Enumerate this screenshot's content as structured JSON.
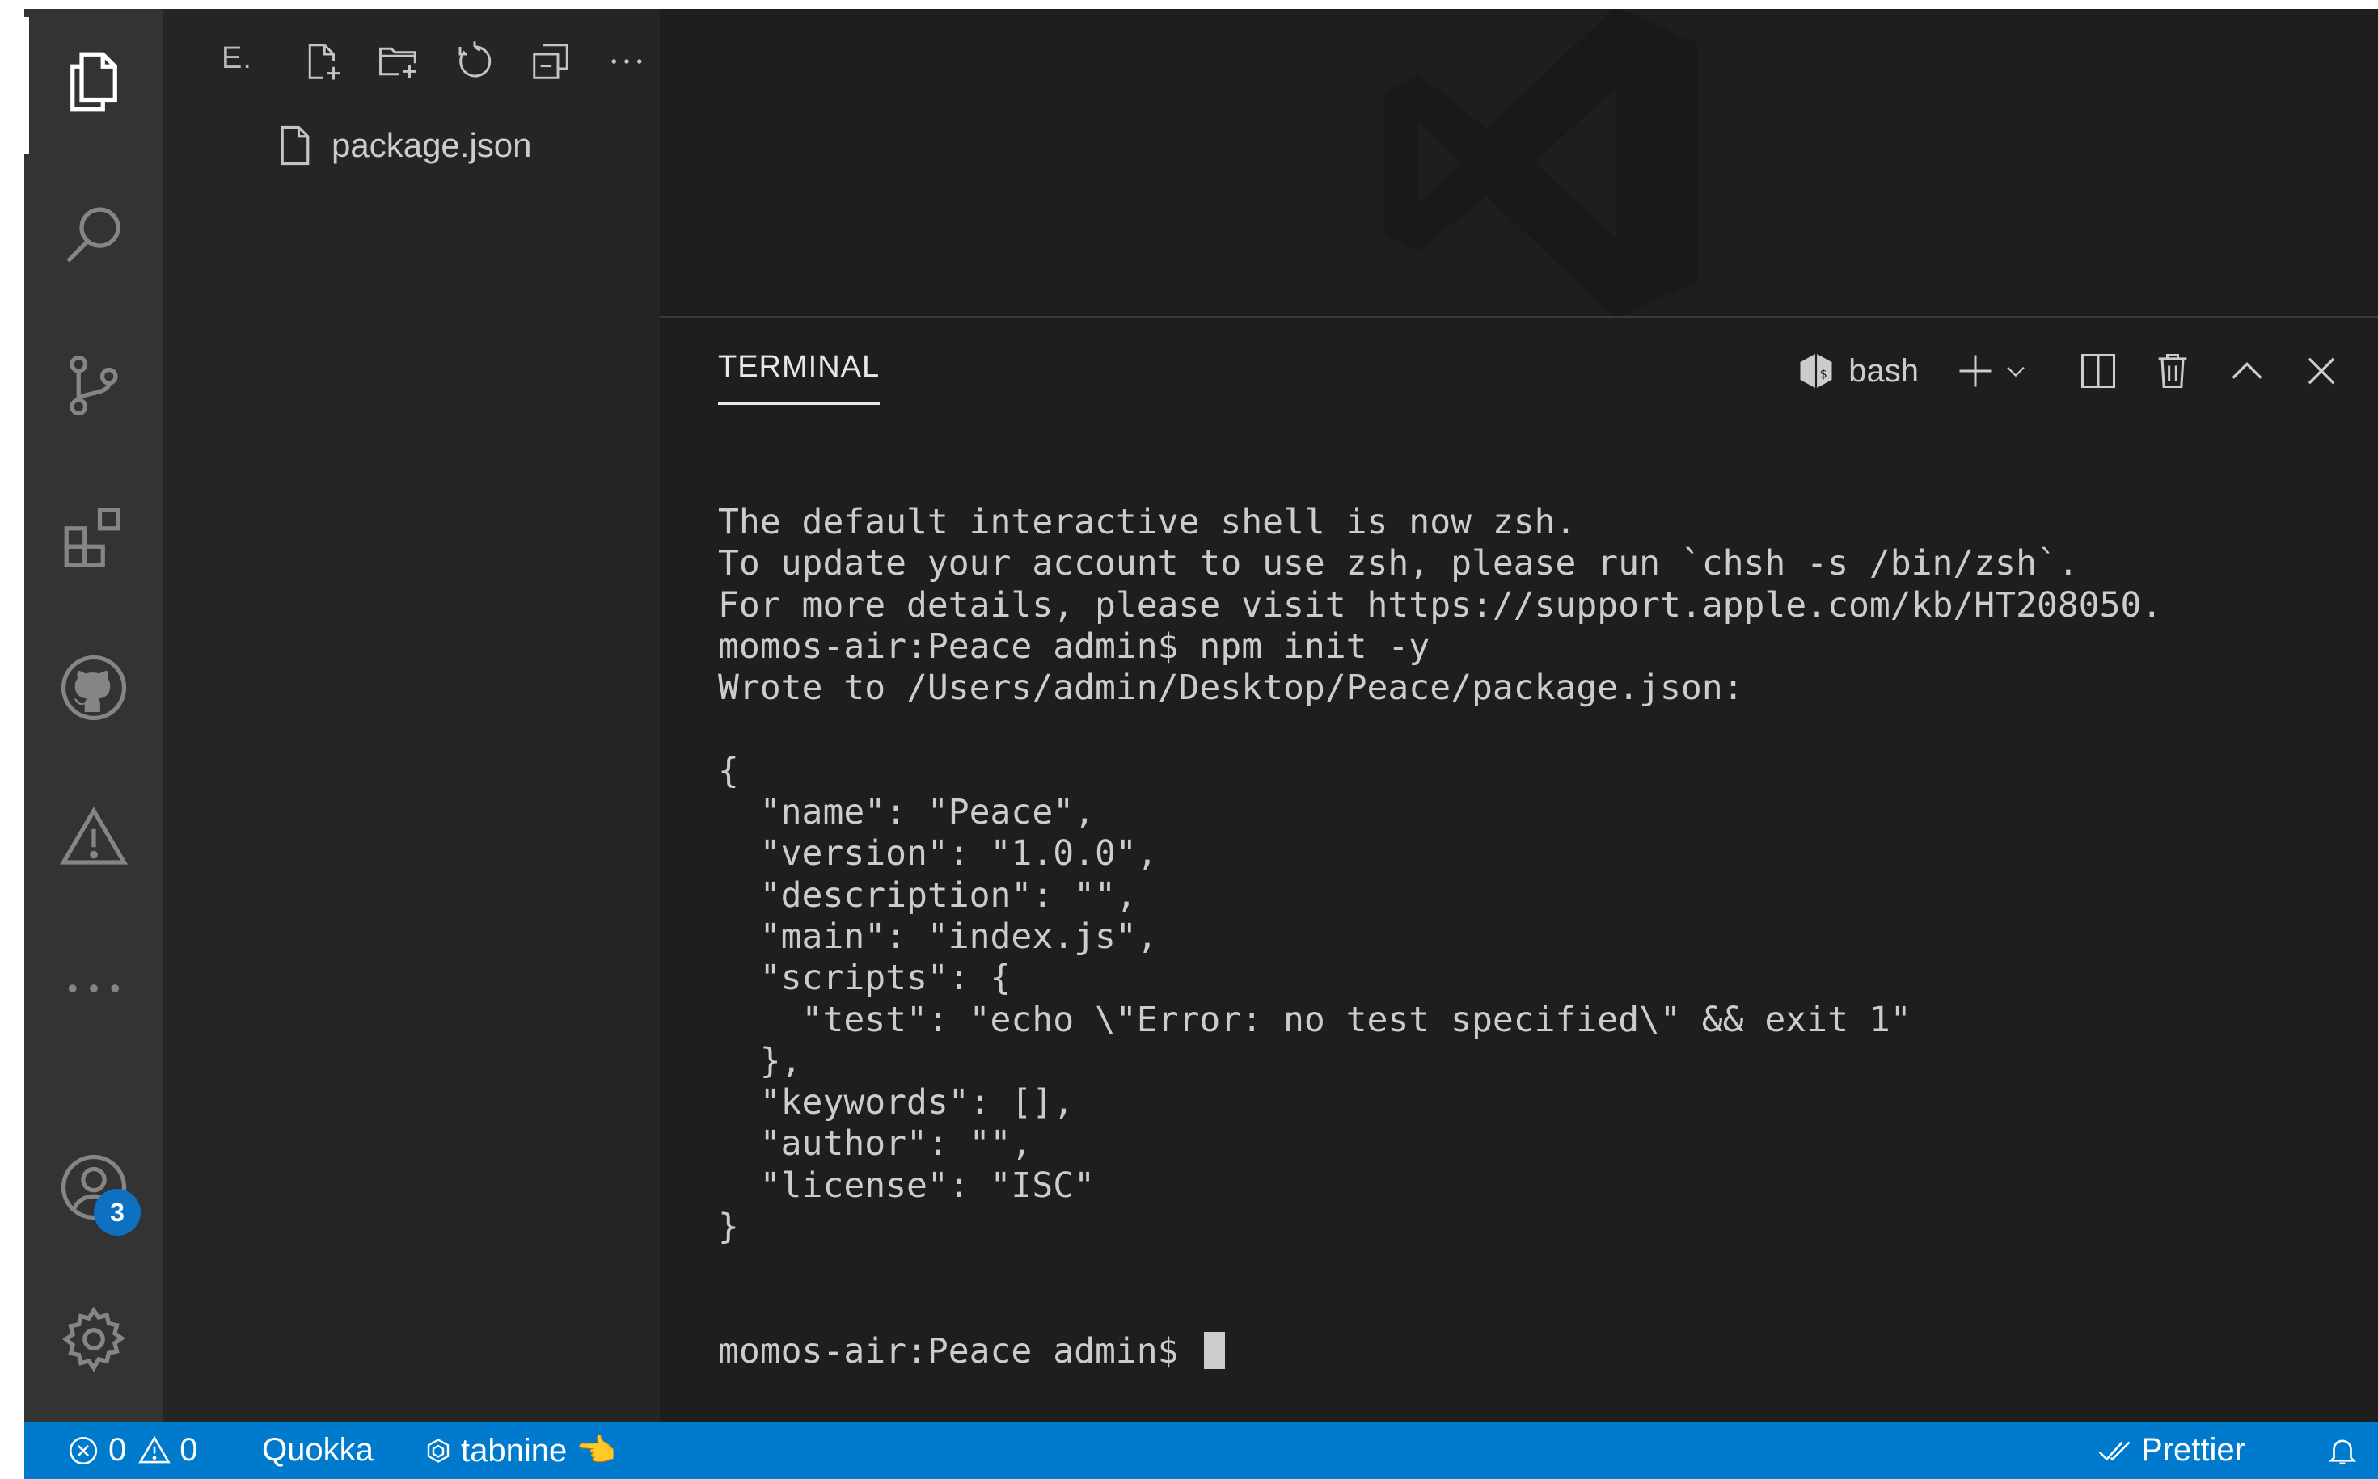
{
  "sidebar": {
    "title": "E.",
    "files": [
      {
        "name": "package.json"
      }
    ]
  },
  "activity_bar": {
    "accounts_badge": "3"
  },
  "panel": {
    "tab_label": "TERMINAL",
    "shell_name": "bash"
  },
  "terminal": {
    "lines": [
      "The default interactive shell is now zsh.",
      "To update your account to use zsh, please run `chsh -s /bin/zsh`.",
      "For more details, please visit https://support.apple.com/kb/HT208050.",
      "momos-air:Peace admin$ npm init -y",
      "Wrote to /Users/admin/Desktop/Peace/package.json:",
      "",
      "{",
      "  \"name\": \"Peace\",",
      "  \"version\": \"1.0.0\",",
      "  \"description\": \"\",",
      "  \"main\": \"index.js\",",
      "  \"scripts\": {",
      "    \"test\": \"echo \\\"Error: no test specified\\\" && exit 1\"",
      "  },",
      "  \"keywords\": [],",
      "  \"author\": \"\",",
      "  \"license\": \"ISC\"",
      "}",
      "",
      ""
    ],
    "prompt": "momos-air:Peace admin$ "
  },
  "status_bar": {
    "errors": "0",
    "warnings": "0",
    "quokka": "Quokka",
    "tabnine": "tabnine 👈",
    "prettier": "Prettier"
  },
  "colors": {
    "statusbar_bg": "#007acc",
    "badge_bg": "#0e70c0",
    "activity_bg": "#333333",
    "sidebar_bg": "#252526",
    "editor_bg": "#1e1e1e"
  },
  "icons": {
    "activity": [
      "explorer-icon",
      "search-icon",
      "source-control-icon",
      "extensions-icon",
      "github-icon",
      "problems-icon",
      "more-icon",
      "accounts-icon",
      "settings-gear-icon"
    ],
    "explorer_toolbar": [
      "new-file-icon",
      "new-folder-icon",
      "refresh-icon",
      "collapse-all-icon",
      "more-actions-icon"
    ],
    "panel_toolbar": [
      "bash-shell-icon",
      "add-terminal-icon",
      "terminal-dropdown-icon",
      "split-terminal-icon",
      "kill-terminal-icon",
      "maximize-panel-icon",
      "close-panel-icon"
    ],
    "status": [
      "error-icon",
      "warning-icon",
      "tabnine-icon",
      "double-check-icon",
      "bell-icon"
    ]
  }
}
